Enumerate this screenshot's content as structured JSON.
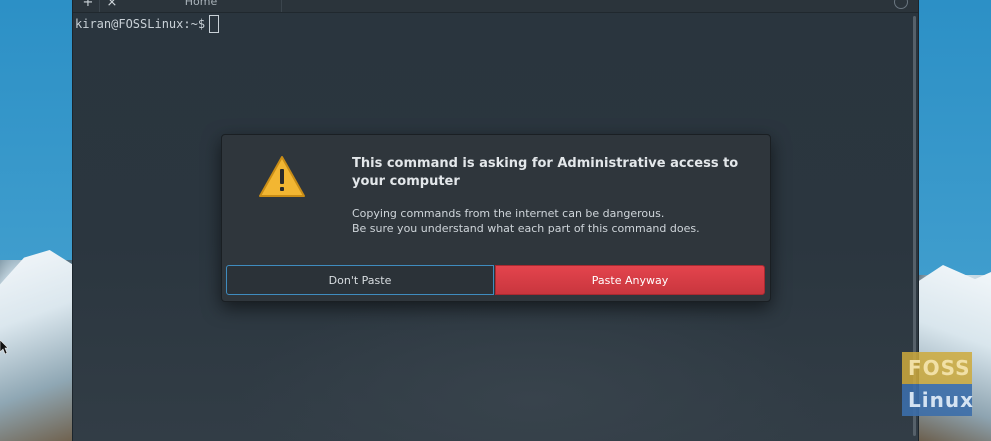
{
  "terminal": {
    "tabs": {
      "new_tab_icon": "+",
      "close_tab_icon": "×",
      "active_tab_label": "Home"
    },
    "prompt": "kiran@FOSSLinux:~$"
  },
  "dialog": {
    "title": "This command is asking for Administrative access to your computer",
    "message_line1": "Copying commands from the internet can be dangerous.",
    "message_line2": "Be sure you understand what each part of this command does.",
    "icon": "warning-icon",
    "cancel_label": "Don't Paste",
    "confirm_label": "Paste Anyway"
  },
  "watermark": {
    "line1": "FOSS",
    "line2": "Linux"
  },
  "colors": {
    "confirm_button": "#d83c44",
    "cancel_focus_border": "#3f8cbf",
    "dialog_bg": "#2f363c",
    "warning_yellow": "#f2b632"
  }
}
